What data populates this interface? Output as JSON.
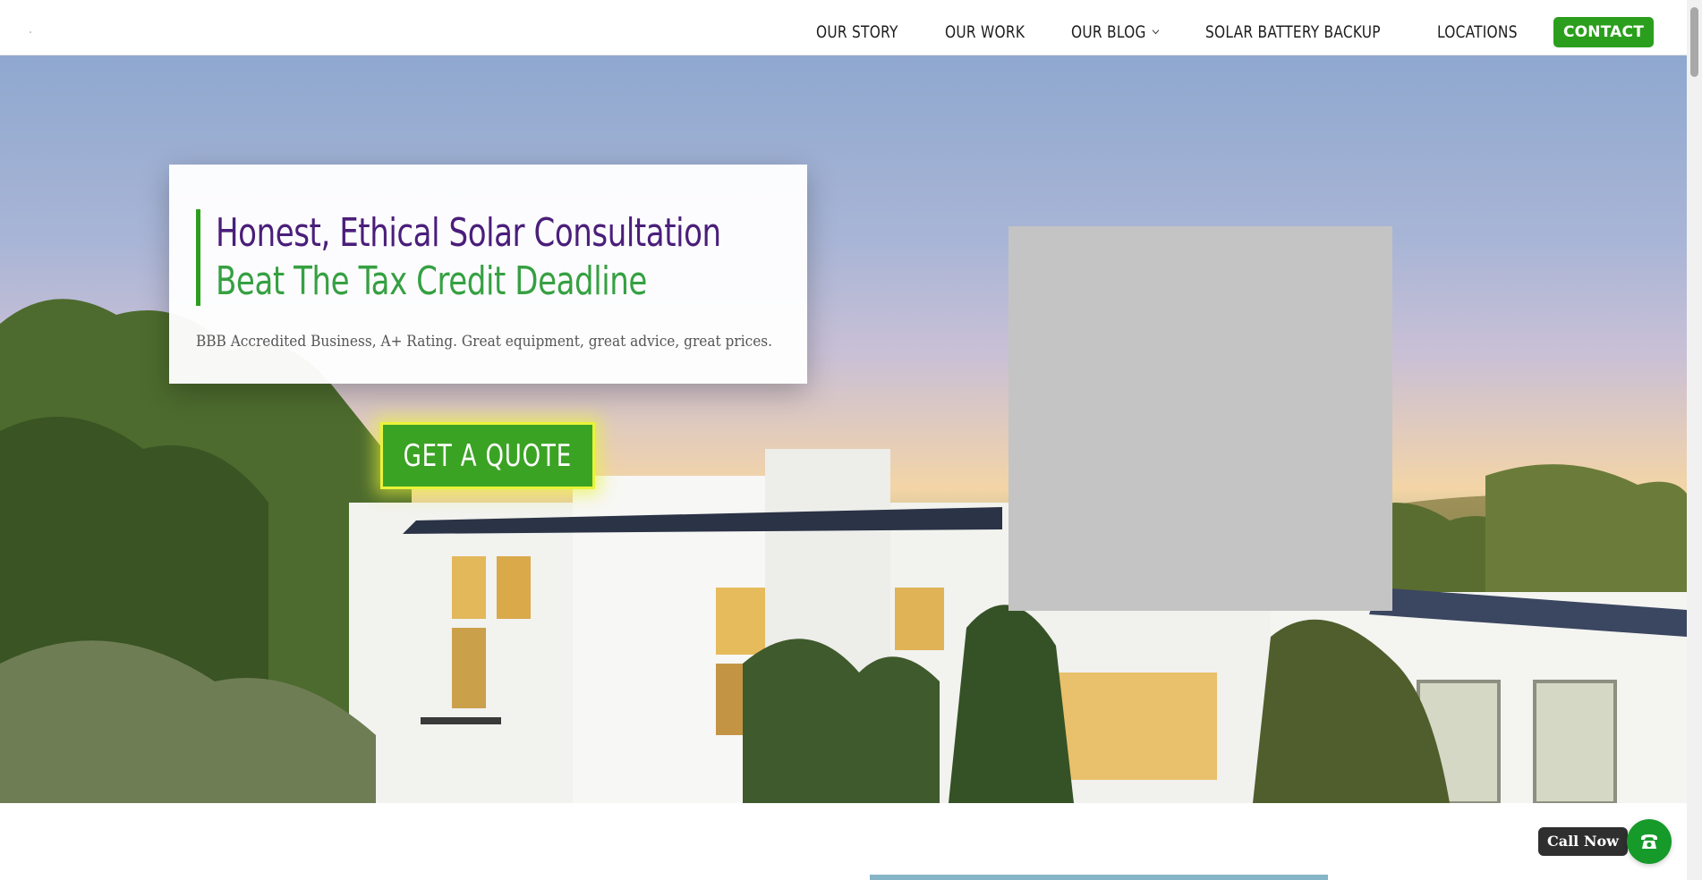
{
  "nav": {
    "items": [
      {
        "label": "OUR STORY"
      },
      {
        "label": "OUR WORK"
      },
      {
        "label": "OUR BLOG"
      },
      {
        "label": "SOLAR BATTERY BACKUP"
      },
      {
        "label": "LOCATIONS"
      }
    ],
    "contact_label": "CONTACT"
  },
  "hero": {
    "title_line1": "Honest, Ethical Solar Consultation",
    "title_line2": "Beat The Tax Credit Deadline",
    "subtitle": "BBB Accredited Business, A+ Rating. Great equipment, great advice, great prices.",
    "cta_label": "GET A QUOTE"
  },
  "call": {
    "label": "Call Now",
    "icon": "phone-icon"
  },
  "colors": {
    "brand_green": "#2b9f1d",
    "title_purple": "#4a1e7a",
    "title_green": "#36a042",
    "cta_glow": "#e8f33a"
  }
}
